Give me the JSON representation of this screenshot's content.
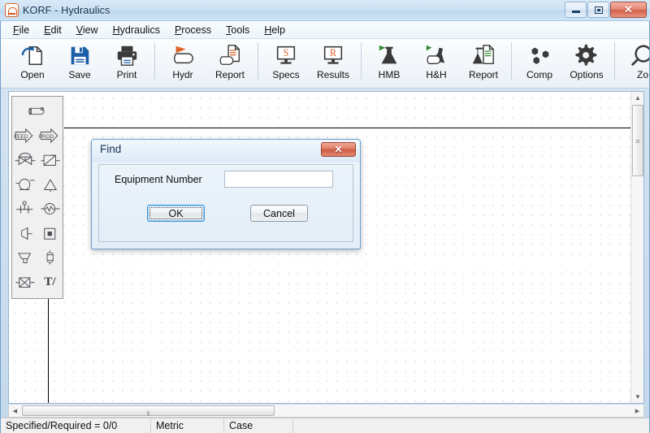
{
  "window": {
    "title": "KORF - Hydraulics",
    "app_icon": "korf-app-icon",
    "buttons": {
      "minimize": "minimize-button",
      "maximize": "maximize-button",
      "close_label": "✕"
    }
  },
  "menubar": {
    "items": [
      {
        "label": "File",
        "accel": "F"
      },
      {
        "label": "Edit",
        "accel": "E"
      },
      {
        "label": "View",
        "accel": "V"
      },
      {
        "label": "Hydraulics",
        "accel": "H"
      },
      {
        "label": "Process",
        "accel": "P"
      },
      {
        "label": "Tools",
        "accel": "T"
      },
      {
        "label": "Help",
        "accel": "H"
      }
    ]
  },
  "toolbar": {
    "groups": [
      {
        "buttons": [
          {
            "label": "Open",
            "icon": "open-folder-page-icon"
          },
          {
            "label": "Save",
            "icon": "floppy-disk-icon"
          },
          {
            "label": "Print",
            "icon": "printer-icon"
          }
        ]
      },
      {
        "buttons": [
          {
            "label": "Hydr",
            "icon": "pipe-run-hydraulics-icon"
          },
          {
            "label": "Report",
            "icon": "pipe-report-document-icon"
          }
        ]
      },
      {
        "buttons": [
          {
            "label": "Specs",
            "icon": "monitor-specs-icon",
            "badge": "S"
          },
          {
            "label": "Results",
            "icon": "monitor-results-icon",
            "badge": "R"
          }
        ]
      },
      {
        "buttons": [
          {
            "label": "HMB",
            "icon": "flask-run-icon"
          },
          {
            "label": "H&H",
            "icon": "flask-pipe-run-icon"
          },
          {
            "label": "Report",
            "icon": "flask-report-document-icon"
          }
        ]
      },
      {
        "buttons": [
          {
            "label": "Comp",
            "icon": "components-hexagons-icon"
          },
          {
            "label": "Options",
            "icon": "gear-icon"
          }
        ]
      },
      {
        "buttons": [
          {
            "label": "Zo",
            "icon": "zoom-magnifier-icon"
          }
        ]
      }
    ]
  },
  "palette": {
    "items": [
      {
        "name": "pipe-segment",
        "glyph": "pipe-segment-icon",
        "wide": true
      },
      {
        "name": "feed-stream",
        "glyph": "feed-arrow-icon",
        "text": "FEED"
      },
      {
        "name": "product-stream",
        "glyph": "product-arrow-icon",
        "text": "PROD"
      },
      {
        "name": "control-valve",
        "glyph": "control-valve-icon"
      },
      {
        "name": "heat-exchanger",
        "glyph": "heat-exchanger-icon"
      },
      {
        "name": "pump",
        "glyph": "pump-icon"
      },
      {
        "name": "column",
        "glyph": "column-icon"
      },
      {
        "name": "instrument-tee",
        "glyph": "instrument-tee-icon"
      },
      {
        "name": "flow-meter",
        "glyph": "flow-meter-icon"
      },
      {
        "name": "reducer",
        "glyph": "reducer-icon"
      },
      {
        "name": "orifice-plate",
        "glyph": "orifice-plate-icon"
      },
      {
        "name": "tee-fitting",
        "glyph": "tee-fitting-icon"
      },
      {
        "name": "vertical-vessel",
        "glyph": "vertical-vessel-icon"
      },
      {
        "name": "gate-valve",
        "glyph": "gate-valve-icon"
      },
      {
        "name": "text-tool",
        "glyph": "text-tool-icon",
        "text": "T/"
      }
    ]
  },
  "canvas": {
    "name": "drawing-canvas",
    "grid": true
  },
  "scrollbars": {
    "vertical": {
      "up": "▲",
      "down": "▼",
      "grip": "≡"
    },
    "horizontal": {
      "left": "◀",
      "right": "▶",
      "grip": "⦀"
    }
  },
  "statusbar": {
    "cells": [
      "Specified/Required = 0/0",
      "Metric",
      "Case",
      ""
    ]
  },
  "dialog": {
    "title": "Find",
    "close_label": "✕",
    "field_label": "Equipment Number",
    "field_value": "",
    "field_placeholder": "",
    "ok_label": "OK",
    "cancel_label": "Cancel"
  },
  "colors": {
    "accent_blue": "#1a5fa8",
    "accent_orange": "#e1632a",
    "accent_green": "#2e8b34",
    "dark_icon": "#3a3a3a"
  }
}
